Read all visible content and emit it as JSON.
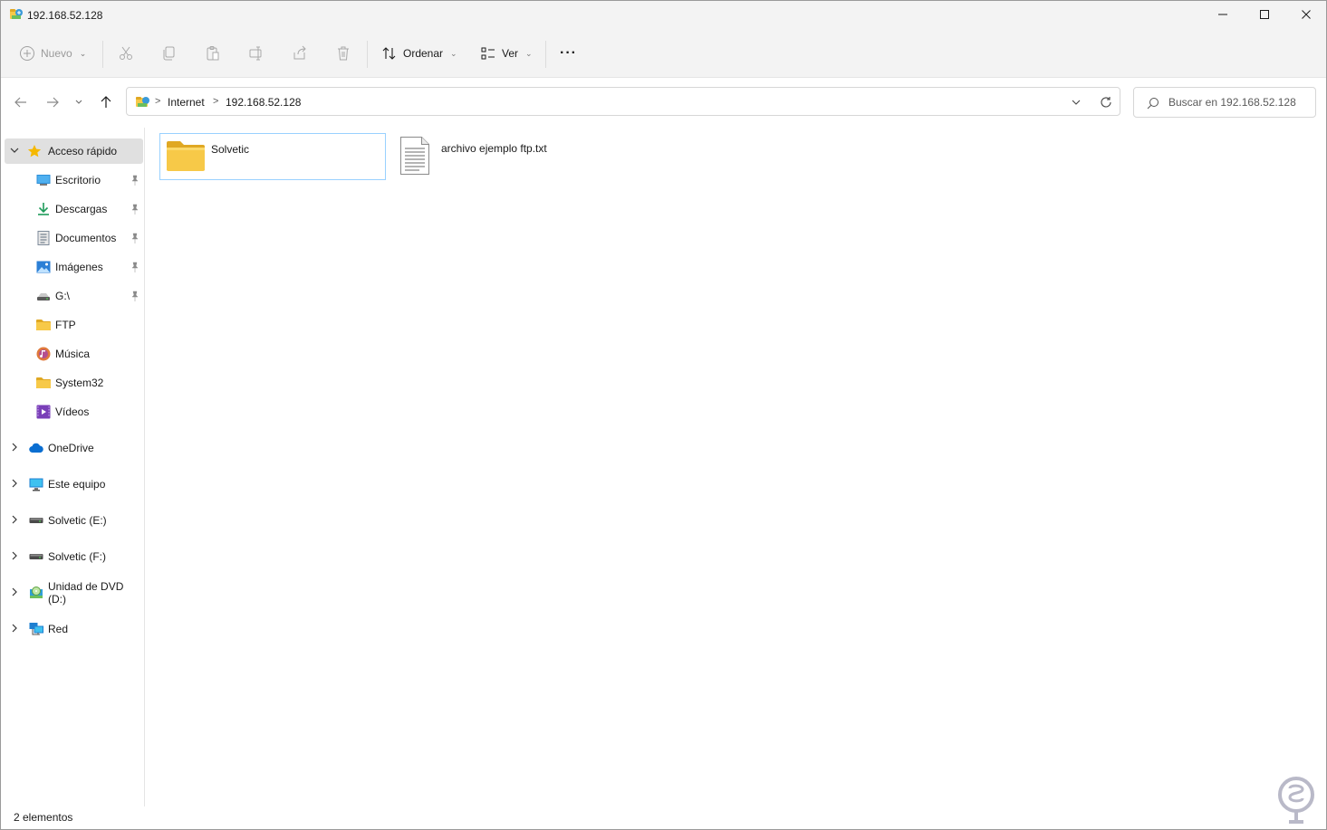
{
  "window": {
    "title": "192.168.52.128"
  },
  "toolbar": {
    "new_label": "Nuevo",
    "sort_label": "Ordenar",
    "view_label": "Ver",
    "more_label": "···"
  },
  "address": {
    "crumbs": [
      "Internet",
      "192.168.52.128"
    ]
  },
  "search": {
    "placeholder": "Buscar en 192.168.52.128"
  },
  "sidebar": {
    "quick_access": "Acceso rápido",
    "items": [
      {
        "label": "Escritorio",
        "icon": "desktop-icon",
        "pinned": true
      },
      {
        "label": "Descargas",
        "icon": "download-icon",
        "pinned": true
      },
      {
        "label": "Documentos",
        "icon": "documents-icon",
        "pinned": true
      },
      {
        "label": "Imágenes",
        "icon": "pictures-icon",
        "pinned": true
      },
      {
        "label": "G:\\",
        "icon": "drive-icon",
        "pinned": true
      },
      {
        "label": "FTP",
        "icon": "folder-icon",
        "pinned": false
      },
      {
        "label": "Música",
        "icon": "music-icon",
        "pinned": false
      },
      {
        "label": "System32",
        "icon": "folder-icon",
        "pinned": false
      },
      {
        "label": "Vídeos",
        "icon": "videos-icon",
        "pinned": false
      }
    ],
    "roots": [
      {
        "label": "OneDrive",
        "icon": "onedrive-icon"
      },
      {
        "label": "Este equipo",
        "icon": "this-pc-icon"
      },
      {
        "label": "Solvetic (E:)",
        "icon": "drive-icon"
      },
      {
        "label": "Solvetic (F:)",
        "icon": "drive-icon"
      },
      {
        "label": "Unidad de DVD (D:)",
        "icon": "dvd-icon"
      },
      {
        "label": "Red",
        "icon": "network-icon"
      }
    ]
  },
  "content": {
    "items": [
      {
        "name": "Solvetic",
        "type": "folder",
        "selected": true
      },
      {
        "name": "archivo ejemplo ftp.txt",
        "type": "text-file",
        "selected": false
      }
    ]
  },
  "status": {
    "count": "2 elementos"
  },
  "colors": {
    "chrome": "#f3f3f3",
    "selection_border": "#99d1ff",
    "folder_yellow": "#f7c948",
    "accent": "#0067c0"
  }
}
